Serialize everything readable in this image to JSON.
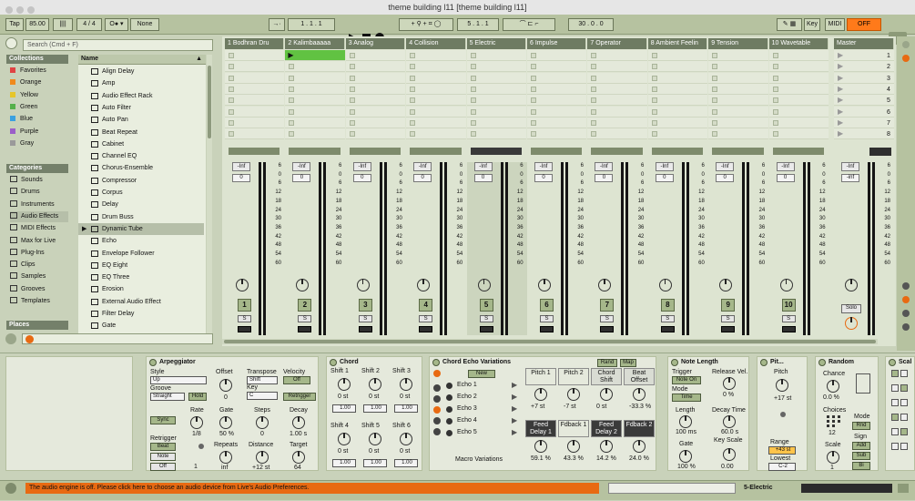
{
  "window": {
    "title": "theme building l11  [theme building l11]"
  },
  "transport": {
    "tap": "Tap",
    "bpm": "85.00",
    "time_sig": "4 / 4",
    "metro": "1 Bar",
    "quant": "None",
    "position": "1 .  1 .  1",
    "loop_start": "5 .  1 .  1",
    "loop_len": "30 .  0 .  0",
    "key": "Key",
    "midi": "MIDI",
    "cpu": "OFF"
  },
  "browser": {
    "search_placeholder": "Search (Cmd + F)",
    "collections_label": "Collections",
    "collections": [
      {
        "label": "Favorites",
        "color": "#e04343"
      },
      {
        "label": "Orange",
        "color": "#f08a1c"
      },
      {
        "label": "Yellow",
        "color": "#e6c62a"
      },
      {
        "label": "Green",
        "color": "#55b04a"
      },
      {
        "label": "Blue",
        "color": "#3aa0e0"
      },
      {
        "label": "Purple",
        "color": "#9a5ec8"
      },
      {
        "label": "Gray",
        "color": "#9a9a9a"
      }
    ],
    "categories_label": "Categories",
    "categories": [
      "Sounds",
      "Drums",
      "Instruments",
      "Audio Effects",
      "MIDI Effects",
      "Max for Live",
      "Plug-Ins",
      "Clips",
      "Samples",
      "Grooves",
      "Templates"
    ],
    "places_label": "Places",
    "name_header": "Name",
    "files": [
      "Align Delay",
      "Amp",
      "Audio Effect Rack",
      "Auto Filter",
      "Auto Pan",
      "Beat Repeat",
      "Cabinet",
      "Channel EQ",
      "Chorus-Ensemble",
      "Compressor",
      "Corpus",
      "Delay",
      "Drum Buss",
      "Dynamic Tube",
      "Echo",
      "Envelope Follower",
      "EQ Eight",
      "EQ Three",
      "Erosion",
      "External Audio Effect",
      "Filter Delay",
      "Gate"
    ]
  },
  "tracks": [
    "1 Bodhran Dru",
    "2 Kalimbaaaaa",
    "3 Analog",
    "4 Collision",
    "5 Electric",
    "6 Impulse",
    "7 Operator",
    "8 Ambient Feelin",
    "9 Tension",
    "10 Wavetable"
  ],
  "master": "Master",
  "scenes": [
    "1",
    "2",
    "3",
    "4",
    "5",
    "6",
    "7",
    "8"
  ],
  "mixer": {
    "vol": "-Inf",
    "pan": "0",
    "master_vol": "-Inf",
    "master_pan": "-inf",
    "solo": "Solo",
    "scale": [
      "6",
      "0",
      "6",
      "12",
      "18",
      "24",
      "30",
      "36",
      "42",
      "48",
      "54",
      "60"
    ],
    "track_nums": [
      "1",
      "2",
      "3",
      "4",
      "5",
      "6",
      "7",
      "8",
      "9",
      "10"
    ],
    "s": "S"
  },
  "devices": {
    "arp": {
      "title": "Arpeggiator",
      "style": "Style",
      "style_val": "Up",
      "groove": "Groove",
      "groove_val": "Straight",
      "hold": "Hold",
      "offset": "Offset",
      "offset_val": "0",
      "transpose": "Transpose",
      "transpose_val": "Shift",
      "key": "Key",
      "key_val": "C",
      "velocity": "Velocity",
      "vel_off": "Off",
      "retrigger_btn": "Retrigger",
      "sync": "Sync",
      "rate": "Rate",
      "rate_val": "1/8",
      "gate": "Gate",
      "gate_val": "50 %",
      "steps": "Steps",
      "steps_val": "0",
      "decay": "Decay",
      "decay_val": "1.00 s",
      "retrigger": "Retrigger",
      "beat": "Beat",
      "note": "Note",
      "off": "Off",
      "repeats": "Repeats",
      "repeats_val": "inf",
      "distance": "Distance",
      "distance_val": "+12 st",
      "target": "Target",
      "target_val": "64",
      "one": "1"
    },
    "chord": {
      "title": "Chord",
      "shifts": [
        "Shift 1",
        "Shift 2",
        "Shift 3",
        "Shift 4",
        "Shift 5",
        "Shift 6"
      ],
      "st": "0 st",
      "vel": "1.00"
    },
    "cev": {
      "title": "Chord Echo Variations",
      "rand": "Rand",
      "map": "Map",
      "new": "New",
      "echoes": [
        "Echo 1",
        "Echo 2",
        "Echo 3",
        "Echo 4",
        "Echo 5"
      ],
      "macro": "Macro Variations",
      "cells": [
        {
          "l": "Pitch 1",
          "v": "+7 st"
        },
        {
          "l": "Pitch 2",
          "v": "-7 st"
        },
        {
          "l": "Chord Shift",
          "v": "0 st"
        },
        {
          "l": "Beat Offset",
          "v": "-33.3 %"
        },
        {
          "l": "Feed Delay 1",
          "v": "59.1 %"
        },
        {
          "l": "Fdback 1",
          "v": "43.3 %"
        },
        {
          "l": "Feed Delay 2",
          "v": "14.2 %"
        },
        {
          "l": "Fdback 2",
          "v": "24.0 %"
        }
      ]
    },
    "nl": {
      "title": "Note Length",
      "trigger": "Trigger",
      "trig_val": "Note On",
      "mode": "Mode",
      "mode_val": "Time",
      "release": "Release Vel.",
      "rel_val": "0 %",
      "length": "Length",
      "len_val": "100 ms",
      "decay": "Decay Time",
      "decay_val": "60.0 s",
      "gate": "Gate",
      "gate_val": "100 %",
      "keyscale": "Key Scale",
      "ks_val": "0.00"
    },
    "pitch": {
      "title": "Pit...",
      "pitch": "Pitch",
      "pitch_val": "+17 st",
      "range": "Range",
      "range_val": "+43 st",
      "lowest": "Lowest",
      "low_val": "C-2"
    },
    "random": {
      "title": "Random",
      "chance": "Chance",
      "chance_val": "0.0 %",
      "choices": "Choices",
      "choices_val": "12",
      "scale": "Scale",
      "scale_val": "1",
      "mode": "Mode",
      "mode_val": "Rnd",
      "sign": "Sign",
      "add": "Add",
      "sub": "Sub",
      "bi": "Bi"
    },
    "scale": {
      "title": "Scal"
    }
  },
  "status": {
    "message": "The audio engine is off. Please click here to choose an audio device from Live's Audio Preferences.",
    "track": "5-Electric"
  }
}
